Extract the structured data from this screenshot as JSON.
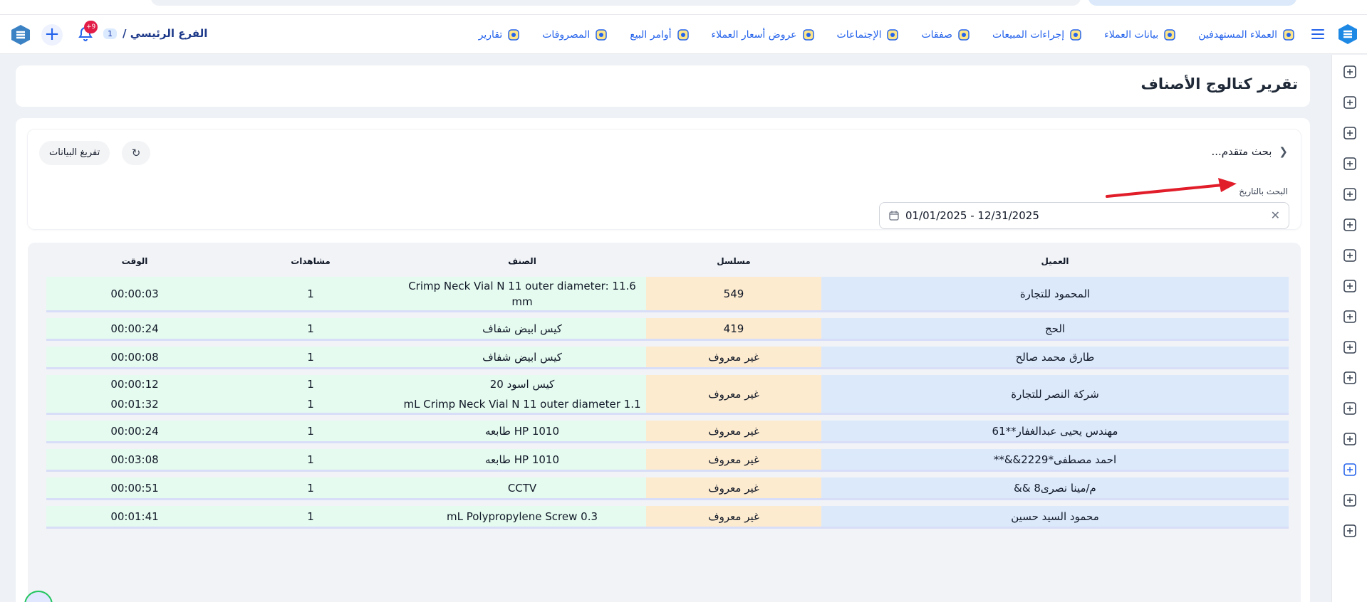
{
  "colors": {
    "accent": "#2563eb",
    "badge": "#e11d48",
    "cell_green": "#e5fbef",
    "cell_orange": "#fdebcf",
    "cell_blue": "#dbe9fb"
  },
  "header": {
    "nav": [
      {
        "label": "العملاء المستهدفين",
        "icon": "target-clients-icon"
      },
      {
        "label": "بيانات العملاء",
        "icon": "client-data-icon"
      },
      {
        "label": "إجراءات المبيعات",
        "icon": "sales-actions-icon"
      },
      {
        "label": "صفقات",
        "icon": "deals-icon"
      },
      {
        "label": "الإجتماعات",
        "icon": "meetings-icon"
      },
      {
        "label": "عروض أسعار العملاء",
        "icon": "quotes-icon"
      },
      {
        "label": "أوامر البيع",
        "icon": "sales-orders-icon"
      },
      {
        "label": "المصروفات",
        "icon": "expenses-icon"
      },
      {
        "label": "تقارير",
        "icon": "reports-icon"
      }
    ],
    "branch_name": "الفرع الرئيسي /",
    "branch_count": "1",
    "notification_count": "+9"
  },
  "page": {
    "title": "تقرير كتالوج الأصناف"
  },
  "filters": {
    "advanced_search": "بحث متقدم...",
    "date_label": "البحث بالتاريخ",
    "date_range": "01/01/2025 - 12/31/2025",
    "export_label": "تفريغ البيانات"
  },
  "table": {
    "headers": {
      "client": "العميل",
      "serial": "مسلسل",
      "item": "الصنف",
      "views": "مشاهدات",
      "time": "الوقت"
    },
    "rows": [
      {
        "client": "المحمود للتجارة",
        "serial": "549",
        "entries": [
          {
            "item": "Crimp Neck Vial N 11 outer diameter: 11.6 mm",
            "views": "1",
            "time": "00:00:03"
          }
        ]
      },
      {
        "client": "الحج",
        "serial": "419",
        "entries": [
          {
            "item": "كيس ابيض شفاف",
            "views": "1",
            "time": "00:00:24"
          }
        ]
      },
      {
        "client": "طارق محمد صالح",
        "serial": "غير معروف",
        "entries": [
          {
            "item": "كيس ابيض شفاف",
            "views": "1",
            "time": "00:00:08"
          }
        ]
      },
      {
        "client": "شركة النصر للتجارة",
        "serial": "غير معروف",
        "entries": [
          {
            "item": "كيس اسود 20",
            "views": "1",
            "time": "00:00:12"
          },
          {
            "item": "mL Crimp Neck Vial N 11 outer diameter 1.1",
            "views": "1",
            "time": "00:01:32"
          }
        ]
      },
      {
        "client": "مهندس يحيى عبدالغفار**61",
        "serial": "غير معروف",
        "entries": [
          {
            "item": "طابعه HP 1010",
            "views": "1",
            "time": "00:00:24"
          }
        ]
      },
      {
        "client": "احمد مصطفى*2229&&**",
        "serial": "غير معروف",
        "entries": [
          {
            "item": "طابعه HP 1010",
            "views": "1",
            "time": "00:03:08"
          }
        ]
      },
      {
        "client": "م/مينا نصرى8       &&",
        "serial": "غير معروف",
        "entries": [
          {
            "item": "CCTV",
            "views": "1",
            "time": "00:00:51"
          }
        ]
      },
      {
        "client": "محمود السيد حسين",
        "serial": "غير معروف",
        "entries": [
          {
            "item": "mL Polypropylene Screw 0.3",
            "views": "1",
            "time": "00:01:41"
          }
        ]
      }
    ]
  }
}
